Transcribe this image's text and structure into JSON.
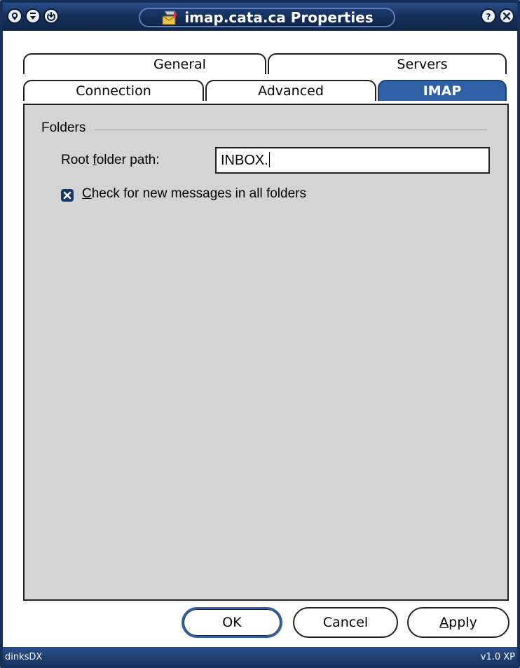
{
  "window": {
    "title": "imap.cata.ca Properties",
    "title_icon": "mailbox-icon",
    "buttons_left": [
      "menu-icon",
      "minimize-icon",
      "maximize-icon"
    ],
    "buttons_right": [
      "help-icon",
      "close-icon"
    ],
    "colors": {
      "titlebar": "#16305a",
      "active_tab": "#2f5fa4",
      "panel": "#d4d4d4"
    }
  },
  "tabs": {
    "row1": [
      {
        "label": "General"
      },
      {
        "label": "Servers"
      }
    ],
    "row2": [
      {
        "label": "Connection"
      },
      {
        "label": "Advanced"
      },
      {
        "label": "IMAP",
        "active": true
      }
    ]
  },
  "folders": {
    "group_label": "Folders",
    "root_path_label_pre": "Root ",
    "root_path_label_mnemonic": "f",
    "root_path_label_post": "older path:",
    "root_path_value": "INBOX.",
    "check_all": {
      "checked": true,
      "label_mnemonic": "C",
      "label_rest": "heck for new messages in all folders"
    }
  },
  "buttons": {
    "ok": "OK",
    "cancel": "Cancel",
    "apply_mnemonic": "A",
    "apply_rest": "pply"
  },
  "status": {
    "left": "dinksDX",
    "right": "v1.0 XP"
  }
}
